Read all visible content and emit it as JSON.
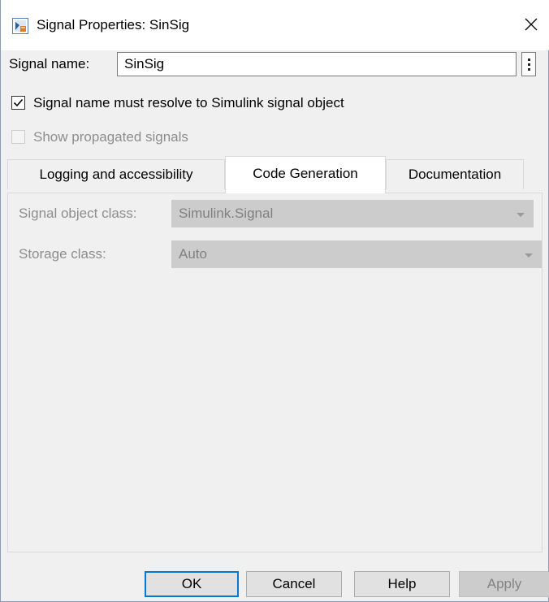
{
  "window": {
    "title": "Signal Properties: SinSig",
    "icon": "simulink-signal-icon"
  },
  "signal": {
    "name_label": "Signal name:",
    "name_value": "SinSig",
    "more_icon": "kebab-menu-icon"
  },
  "options": {
    "resolve_label": "Signal name must resolve to Simulink signal object",
    "resolve_checked": true,
    "propagated_label": "Show propagated signals",
    "propagated_checked": false
  },
  "tabs": [
    {
      "label": "Logging and accessibility",
      "active": false
    },
    {
      "label": "Code Generation",
      "active": true
    },
    {
      "label": "Documentation",
      "active": false
    }
  ],
  "code_generation": {
    "object_class_label": "Signal object class:",
    "object_class_value": "Simulink.Signal",
    "storage_class_label": "Storage class:",
    "storage_class_value": "Auto"
  },
  "buttons": {
    "ok": "OK",
    "cancel": "Cancel",
    "help": "Help",
    "apply": "Apply"
  },
  "colors": {
    "default_button_border": "#0078d7",
    "disabled_field": "#cccccc"
  }
}
